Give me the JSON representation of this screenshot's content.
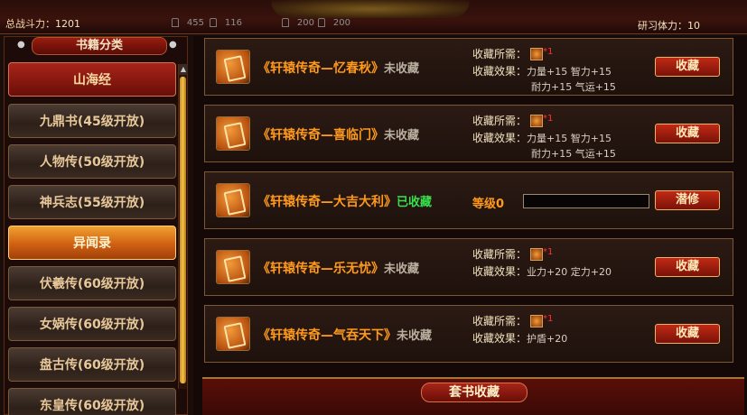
{
  "header": {
    "total_power_label": "总战斗力：",
    "total_power_value": "1201",
    "locked_slots": [
      "455",
      "116",
      "200",
      "200"
    ],
    "stamina_label": "研习体力：",
    "stamina_value": "10"
  },
  "sidebar": {
    "title": "书籍分类",
    "categories": [
      {
        "label": "山海经",
        "state": "selected"
      },
      {
        "label": "九鼎书(45级开放)",
        "state": "locked"
      },
      {
        "label": "人物传(50级开放)",
        "state": "locked"
      },
      {
        "label": "神兵志(55级开放)",
        "state": "locked"
      },
      {
        "label": "异闻录",
        "state": "highlight"
      },
      {
        "label": "伏羲传(60级开放)",
        "state": "locked"
      },
      {
        "label": "女娲传(60级开放)",
        "state": "locked"
      },
      {
        "label": "盘古传(60级开放)",
        "state": "locked"
      },
      {
        "label": "东皇传(60级开放)",
        "state": "locked"
      }
    ]
  },
  "books": [
    {
      "title": "《轩辕传奇—忆春秋》",
      "status": "未收藏",
      "req_label": "收藏所需：",
      "req_count": "*1",
      "effect_label": "收藏效果：",
      "effect_line1": "力量+15  智力+15",
      "effect_line2": "耐力+15  气运+15",
      "button": "收藏"
    },
    {
      "title": "《轩辕传奇—喜临门》",
      "status": "未收藏",
      "req_label": "收藏所需：",
      "req_count": "*1",
      "effect_label": "收藏效果：",
      "effect_line1": "力量+15  智力+15",
      "effect_line2": "耐力+15  气运+15",
      "button": "收藏"
    },
    {
      "title": "《轩辕传奇—大吉大利》",
      "status": "已收藏",
      "level_label": "等级0",
      "button": "潜修"
    },
    {
      "title": "《轩辕传奇—乐无忧》",
      "status": "未收藏",
      "req_label": "收藏所需：",
      "req_count": "*1",
      "effect_label": "收藏效果：",
      "effect_line1": "业力+20  定力+20",
      "button": "收藏"
    },
    {
      "title": "《轩辕传奇—气吞天下》",
      "status": "未收藏",
      "req_label": "收藏所需：",
      "req_count": "*1",
      "effect_label": "收藏效果：",
      "effect_line1": "护盾+20",
      "button": "收藏"
    }
  ],
  "footer": {
    "set_title": "套书收藏"
  }
}
